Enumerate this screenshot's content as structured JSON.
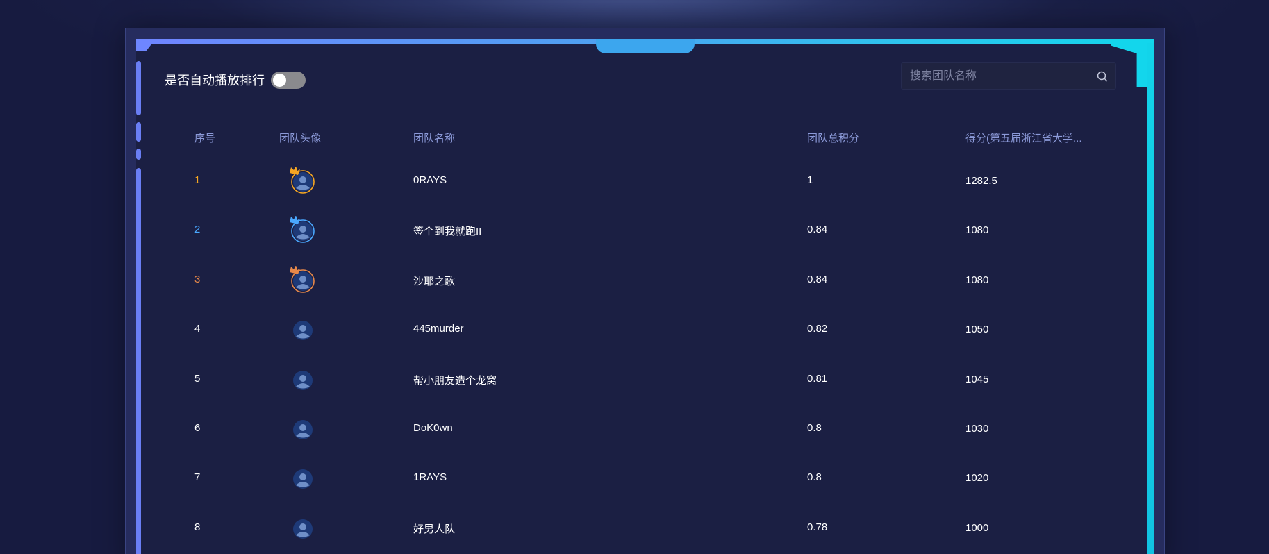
{
  "toolbar": {
    "autoplay_label": "是否自动播放排行",
    "autoplay_on": false
  },
  "search": {
    "placeholder": "搜索团队名称",
    "value": ""
  },
  "table": {
    "columns": {
      "index": "序号",
      "avatar": "团队头像",
      "name": "团队名称",
      "total": "团队总积分",
      "score": "得分(第五届浙江省大学..."
    },
    "rows": [
      {
        "index": "1",
        "name": "0RAYS",
        "total": "1",
        "score": "1282.5",
        "medal": "gold"
      },
      {
        "index": "2",
        "name": "签个到我就跑II",
        "total": "0.84",
        "score": "1080",
        "medal": "silver"
      },
      {
        "index": "3",
        "name": "沙耶之歌",
        "total": "0.84",
        "score": "1080",
        "medal": "bronze"
      },
      {
        "index": "4",
        "name": "445murder",
        "total": "0.82",
        "score": "1050",
        "medal": ""
      },
      {
        "index": "5",
        "name": "帮小朋友造个龙窝",
        "total": "0.81",
        "score": "1045",
        "medal": ""
      },
      {
        "index": "6",
        "name": "DoK0wn",
        "total": "0.8",
        "score": "1030",
        "medal": ""
      },
      {
        "index": "7",
        "name": "1RAYS",
        "total": "0.8",
        "score": "1020",
        "medal": ""
      },
      {
        "index": "8",
        "name": "好男人队",
        "total": "0.78",
        "score": "1000",
        "medal": ""
      }
    ]
  },
  "colors": {
    "gold": "#f5a623",
    "silver": "#4aa8ff",
    "bronze": "#e8894a",
    "header_text": "#8c9ad9",
    "accent_left": "#6e86ff",
    "accent_right": "#13d6ec"
  }
}
